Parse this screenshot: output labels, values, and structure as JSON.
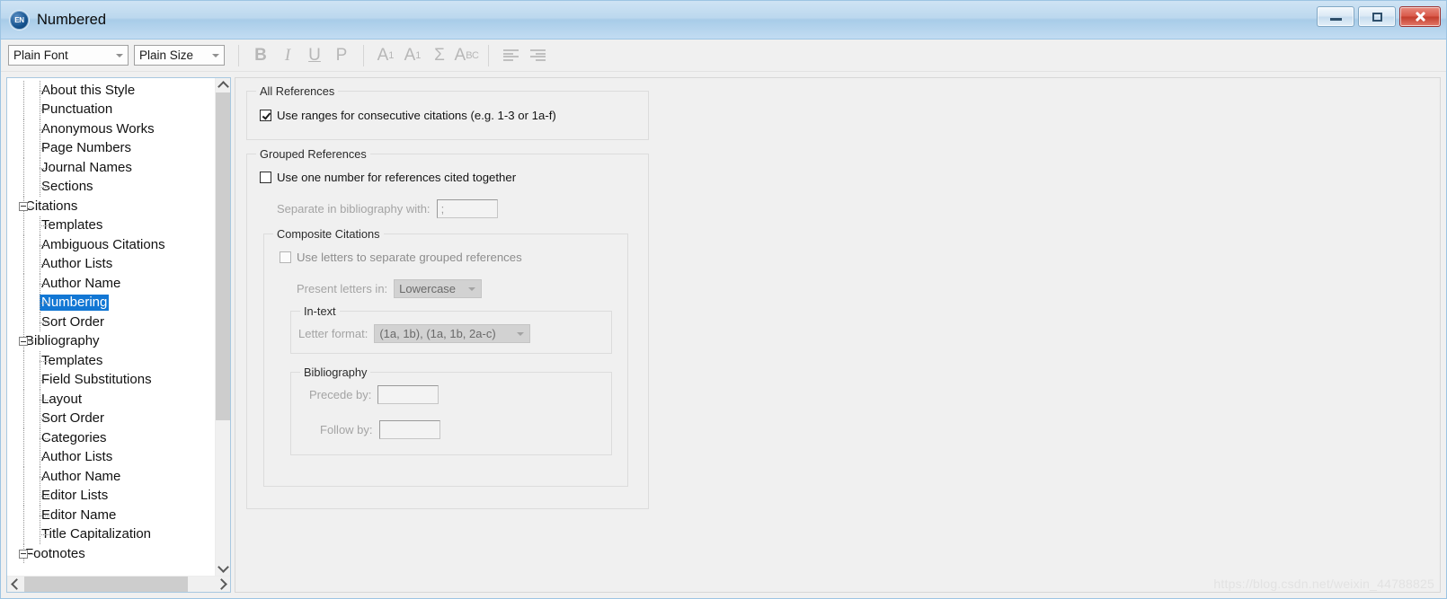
{
  "window": {
    "title": "Numbered",
    "app_icon": "EN",
    "controls": {
      "minimize": "minimize-button",
      "restore": "restore-button",
      "close": "close-button"
    }
  },
  "toolbar": {
    "font_combo": {
      "value": "Plain Font"
    },
    "size_combo": {
      "value": "Plain Size"
    },
    "buttons": [
      {
        "name": "bold-button",
        "glyph": "B",
        "enabled": false
      },
      {
        "name": "italic-button",
        "glyph": "I",
        "enabled": false
      },
      {
        "name": "underline-button",
        "glyph": "U",
        "enabled": false
      },
      {
        "name": "plain-button",
        "glyph": "P",
        "enabled": false
      },
      {
        "name": "superscript-button",
        "glyph": "A1",
        "enabled": false
      },
      {
        "name": "subscript-button",
        "glyph": "A1",
        "enabled": false
      },
      {
        "name": "symbol-button",
        "glyph": "Σ",
        "enabled": false
      },
      {
        "name": "spellcheck-button",
        "glyph": "ABC",
        "enabled": false
      },
      {
        "name": "align-left-button",
        "glyph": "align-left",
        "enabled": false
      },
      {
        "name": "align-right-button",
        "glyph": "align-right",
        "enabled": false
      }
    ]
  },
  "tree": {
    "items": [
      {
        "label": "About this Style",
        "level": 1,
        "expander": false,
        "selected": false
      },
      {
        "label": "Punctuation",
        "level": 1,
        "expander": false,
        "selected": false
      },
      {
        "label": "Anonymous Works",
        "level": 1,
        "expander": false,
        "selected": false
      },
      {
        "label": "Page Numbers",
        "level": 1,
        "expander": false,
        "selected": false
      },
      {
        "label": "Journal Names",
        "level": 1,
        "expander": false,
        "selected": false
      },
      {
        "label": "Sections",
        "level": 1,
        "expander": false,
        "selected": false
      },
      {
        "label": "Citations",
        "level": 0,
        "expander": true,
        "selected": false
      },
      {
        "label": "Templates",
        "level": 1,
        "expander": false,
        "selected": false
      },
      {
        "label": "Ambiguous Citations",
        "level": 1,
        "expander": false,
        "selected": false
      },
      {
        "label": "Author Lists",
        "level": 1,
        "expander": false,
        "selected": false
      },
      {
        "label": "Author Name",
        "level": 1,
        "expander": false,
        "selected": false
      },
      {
        "label": "Numbering",
        "level": 1,
        "expander": false,
        "selected": true
      },
      {
        "label": "Sort Order",
        "level": 1,
        "expander": false,
        "selected": false
      },
      {
        "label": "Bibliography",
        "level": 0,
        "expander": true,
        "selected": false
      },
      {
        "label": "Templates",
        "level": 1,
        "expander": false,
        "selected": false
      },
      {
        "label": "Field Substitutions",
        "level": 1,
        "expander": false,
        "selected": false
      },
      {
        "label": "Layout",
        "level": 1,
        "expander": false,
        "selected": false
      },
      {
        "label": "Sort Order",
        "level": 1,
        "expander": false,
        "selected": false
      },
      {
        "label": "Categories",
        "level": 1,
        "expander": false,
        "selected": false
      },
      {
        "label": "Author Lists",
        "level": 1,
        "expander": false,
        "selected": false
      },
      {
        "label": "Author Name",
        "level": 1,
        "expander": false,
        "selected": false
      },
      {
        "label": "Editor Lists",
        "level": 1,
        "expander": false,
        "selected": false
      },
      {
        "label": "Editor Name",
        "level": 1,
        "expander": false,
        "selected": false
      },
      {
        "label": "Title Capitalization",
        "level": 1,
        "expander": false,
        "selected": false
      },
      {
        "label": "Footnotes",
        "level": 0,
        "expander": true,
        "selected": false
      }
    ],
    "selection_color": "#1277d4"
  },
  "panel": {
    "all_references": {
      "title": "All References",
      "use_ranges": {
        "label": "Use ranges for consecutive citations (e.g. 1-3 or 1a-f)",
        "checked": true
      }
    },
    "grouped_references": {
      "title": "Grouped References",
      "use_one_number": {
        "label": "Use one number for references cited together",
        "checked": false
      },
      "separate_in_bibliography": {
        "label": "Separate in bibliography with:",
        "value": ";"
      },
      "composite_citations": {
        "title": "Composite Citations",
        "use_letters": {
          "label": "Use letters to separate grouped references",
          "checked": false
        },
        "present_letters_in": {
          "label": "Present letters in:",
          "value": "Lowercase"
        },
        "in_text": {
          "title": "In-text",
          "letter_format": {
            "label": "Letter format:",
            "value": "(1a, 1b), (1a, 1b, 2a-c)"
          }
        },
        "bibliography": {
          "title": "Bibliography",
          "precede_by": {
            "label": "Precede by:",
            "value": ""
          },
          "follow_by": {
            "label": "Follow by:",
            "value": ""
          }
        }
      }
    }
  },
  "watermark": {
    "text": "https://blog.csdn.net/weixin_44788825"
  }
}
